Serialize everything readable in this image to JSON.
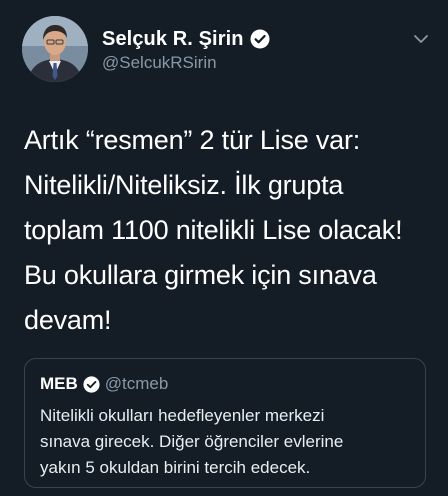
{
  "tweet": {
    "author": {
      "display_name": "Selçuk R. Şirin",
      "handle": "@SelcukRSirin",
      "verified_icon": "verified-badge-icon",
      "avatar_icon": "profile-photo"
    },
    "menu_icon": "chevron-down-icon",
    "text_lines": [
      "Artık “resmen” 2 tür Lise var:",
      "Nitelikli/Niteliksiz. İlk grupta",
      "toplam 1100 nitelikli Lise olacak!",
      "Bu okullara girmek için sınava",
      "devam!"
    ],
    "quoted": {
      "display_name": "MEB",
      "handle": "@tcmeb",
      "verified_icon": "verified-badge-icon",
      "text_lines": [
        "Nitelikli okulları hedefleyenler merkezi",
        "sınava girecek. Diğer öğrenciler evlerine",
        "yakın 5 okuldan birini tercih edecek."
      ]
    }
  },
  "colors": {
    "background": "#141d26",
    "text": "#ffffff",
    "secondary_text": "#8899a6",
    "border": "#38444d"
  }
}
